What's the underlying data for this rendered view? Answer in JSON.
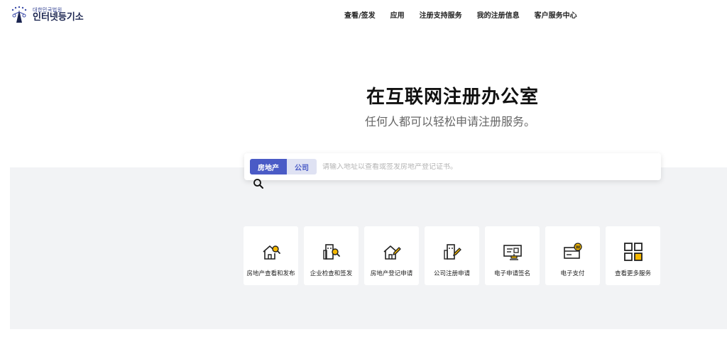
{
  "logo": {
    "small_text": "대한민국법원",
    "main_text": "인터넷등기소"
  },
  "nav": {
    "items": [
      "查看/签发",
      "应用",
      "注册支持服务",
      "我的注册信息",
      "客户服务中心"
    ]
  },
  "hero": {
    "title": "在互联网注册办公室",
    "subtitle": "任何人都可以轻松申请注册服务。"
  },
  "search": {
    "tabs": [
      "房地产",
      "公司"
    ],
    "active_tab": "房地产",
    "placeholder": "请输入地址以查看或签发房地产登记证书。",
    "value": ""
  },
  "services": [
    {
      "label": "房地产查看和发布",
      "icon": "house-search-icon"
    },
    {
      "label": "企业检查和签发",
      "icon": "building-search-icon"
    },
    {
      "label": "房地产登记申请",
      "icon": "house-edit-icon"
    },
    {
      "label": "公司注册申请",
      "icon": "building-edit-icon"
    },
    {
      "label": "电子申请签名",
      "icon": "e-signature-icon"
    },
    {
      "label": "电子支付",
      "icon": "e-payment-icon"
    },
    {
      "label": "查看更多服务",
      "icon": "grid-more-icon"
    }
  ],
  "colors": {
    "accent": "#4a5bc6",
    "accent_light": "#dfe2f3",
    "icon_yellow": "#f5b800",
    "band_gray": "#f2f3f5"
  }
}
